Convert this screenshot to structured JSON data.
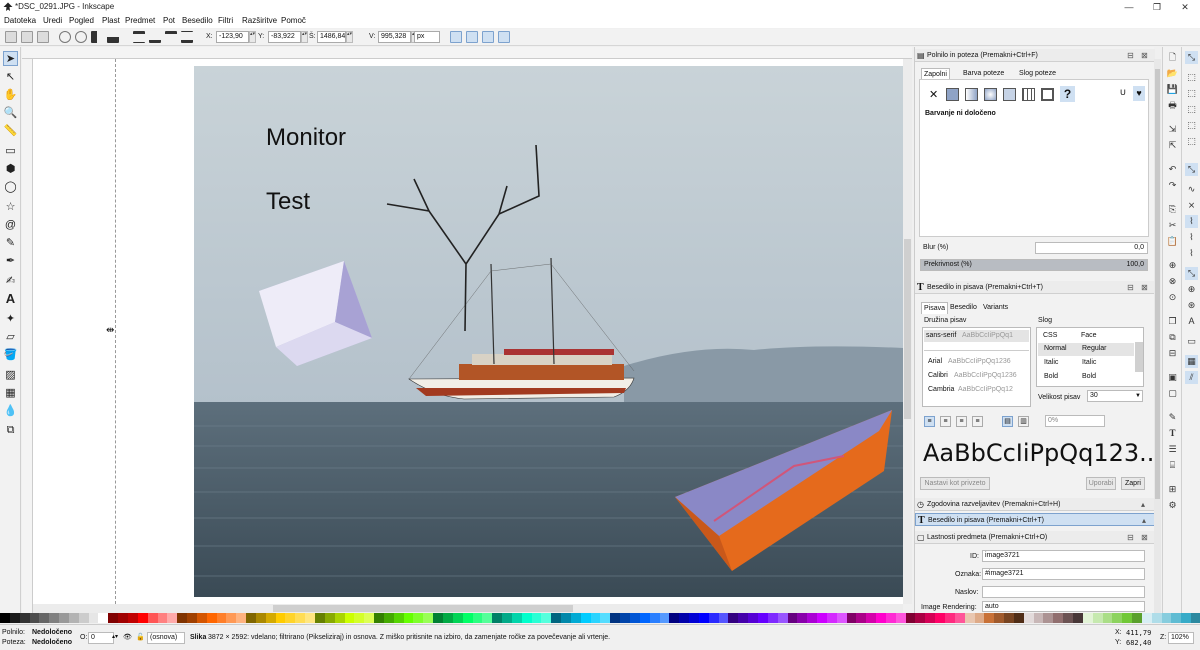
{
  "window": {
    "title": "*DSC_0291.JPG - Inkscape",
    "minimize": "—",
    "maximize": "❐",
    "close": "✕"
  },
  "menu": [
    "Datoteka",
    "Uredi",
    "Pogled",
    "Plast",
    "Predmet",
    "Pot",
    "Besedilo",
    "Filtri",
    "Razširitve",
    "Pomoč"
  ],
  "controls": {
    "x_label": "X:",
    "x_value": "-123,90",
    "y_label": "Y:",
    "y_value": "-83,922",
    "w_label": "Š:",
    "w_value": "1486,84",
    "h_label": "V:",
    "h_value": "995,328",
    "unit": "px"
  },
  "canvas": {
    "text_line1": "Monitor",
    "text_line2": "Test"
  },
  "fill_stroke": {
    "header": "Polnilo in poteza  (Premakni+Ctrl+F)",
    "tabs": [
      "Zapolni",
      "Barva poteze",
      "Slog poteze"
    ],
    "no_paint": "✕",
    "unknown": "?",
    "status": "Barvanje ni določeno",
    "blur_label": "Blur (%)",
    "blur_value": "0,0",
    "opacity_label": "Prekrivnost (%)",
    "opacity_value": "100,0",
    "opacity_level": 1.0
  },
  "text_font": {
    "header": "Besedilo in pisava  (Premakni+Ctrl+T)",
    "tabs": [
      "Pisava",
      "Besedilo",
      "Variants"
    ],
    "family_label": "Družina pisav",
    "style_label": "Slog",
    "families": [
      {
        "name": "sans-serif",
        "sample": "AaBbCcIiPpQq1"
      },
      {
        "name": "Arial",
        "sample": "AaBbCcIiPpQq1236"
      },
      {
        "name": "Calibri",
        "sample": "AaBbCcIiPpQq1236"
      },
      {
        "name": "Cambria",
        "sample": "AaBbCcIiPpQq12"
      }
    ],
    "style_headers": [
      "CSS",
      "Face"
    ],
    "styles": [
      {
        "css": "Normal",
        "face": "Regular"
      },
      {
        "css": "Italic",
        "face": "Italic"
      },
      {
        "css": "Bold",
        "face": "Bold"
      }
    ],
    "size_label": "Velikost pisav",
    "size_value": "30",
    "spacing_value": "0%",
    "preview": "AaBbCcIiPpQq123...",
    "set_default": "Nastavi kot privzeto",
    "apply": "Uporabi",
    "close": "Zapri"
  },
  "collapsed_panels": [
    "Zgodovina razveljavitev  (Premakni+Ctrl+H)",
    "Besedilo in pisava  (Premakni+Ctrl+T)"
  ],
  "object_props": {
    "header": "Lastnosti predmeta  (Premakni+Ctrl+O)",
    "id_label": "ID:",
    "id_value": "image3721",
    "label_label": "Oznaka:",
    "label_value": "#image3721",
    "title_label": "Naslov:",
    "title_value": "",
    "rendering_label": "Image Rendering:",
    "rendering_value": "auto"
  },
  "status": {
    "fill_label": "Polnilo:",
    "fill_value": "Nedoločeno",
    "stroke_label": "Poteza:",
    "stroke_value": "Nedoločeno",
    "opacity_label": "O:",
    "opacity_value": "0",
    "layer": "(osnova)",
    "message_bold": "Slika",
    "message": "3872 × 2592: vdelano; filtrirano (Pikseliziraj) in osnova. Z miško pritisnite na izbiro, da zamenjate ročke za povečevanje ali vrtenje.",
    "cx_label": "X:",
    "cx_value": "411,79",
    "cy_label": "Y:",
    "cy_value": "682,40",
    "zoom_label": "Z:",
    "zoom_value": "102%"
  },
  "palette": [
    "#000000",
    "#1a1a1a",
    "#333333",
    "#4d4d4d",
    "#666666",
    "#808080",
    "#999999",
    "#b3b3b3",
    "#cccccc",
    "#e6e6e6",
    "#ffffff",
    "#800000",
    "#a00000",
    "#c00000",
    "#ff0000",
    "#ff5555",
    "#ff8080",
    "#ffaaaa",
    "#803300",
    "#a04000",
    "#d45500",
    "#ff6600",
    "#ff7f2a",
    "#ff9955",
    "#ffb380",
    "#806600",
    "#aa8800",
    "#d4aa00",
    "#ffcc00",
    "#ffd42a",
    "#ffdd55",
    "#ffe680",
    "#668000",
    "#88aa00",
    "#aad400",
    "#ccff00",
    "#d4ff2a",
    "#ddff55",
    "#338000",
    "#44aa00",
    "#55d400",
    "#66ff00",
    "#7fff2a",
    "#99ff55",
    "#008033",
    "#00aa44",
    "#00d455",
    "#00ff66",
    "#2aff80",
    "#55ff99",
    "#008066",
    "#00aa88",
    "#00d4aa",
    "#00ffcc",
    "#2affd5",
    "#55ffdd",
    "#006680",
    "#0088aa",
    "#00aad4",
    "#00ccff",
    "#2ad4ff",
    "#55ddff",
    "#003380",
    "#0044aa",
    "#0055d4",
    "#0066ff",
    "#2a7fff",
    "#5599ff",
    "#000080",
    "#0000aa",
    "#0000d4",
    "#0000ff",
    "#2a2aff",
    "#5555ff",
    "#330080",
    "#4400aa",
    "#5500d4",
    "#6600ff",
    "#7f2aff",
    "#9955ff",
    "#660080",
    "#8800aa",
    "#aa00d4",
    "#cc00ff",
    "#d42aff",
    "#dd55ff",
    "#800066",
    "#aa0088",
    "#d400aa",
    "#ff00cc",
    "#ff2ad4",
    "#ff55dd",
    "#800033",
    "#aa0044",
    "#d40055",
    "#ff0066",
    "#ff2a7f",
    "#ff5599",
    "#e9c6af",
    "#deaa87",
    "#c87137",
    "#a05a2c",
    "#784421",
    "#502d16",
    "#e3dbdb",
    "#c8b7b7",
    "#ac9393",
    "#916f6f",
    "#6c5353",
    "#483737",
    "#e3f4d7",
    "#c6e9af",
    "#aade87",
    "#8dd35f",
    "#71c837",
    "#5aa02c",
    "#d7eef4",
    "#afdde9",
    "#87cdde",
    "#5fbcd3",
    "#37abc8",
    "#2c89a0"
  ]
}
